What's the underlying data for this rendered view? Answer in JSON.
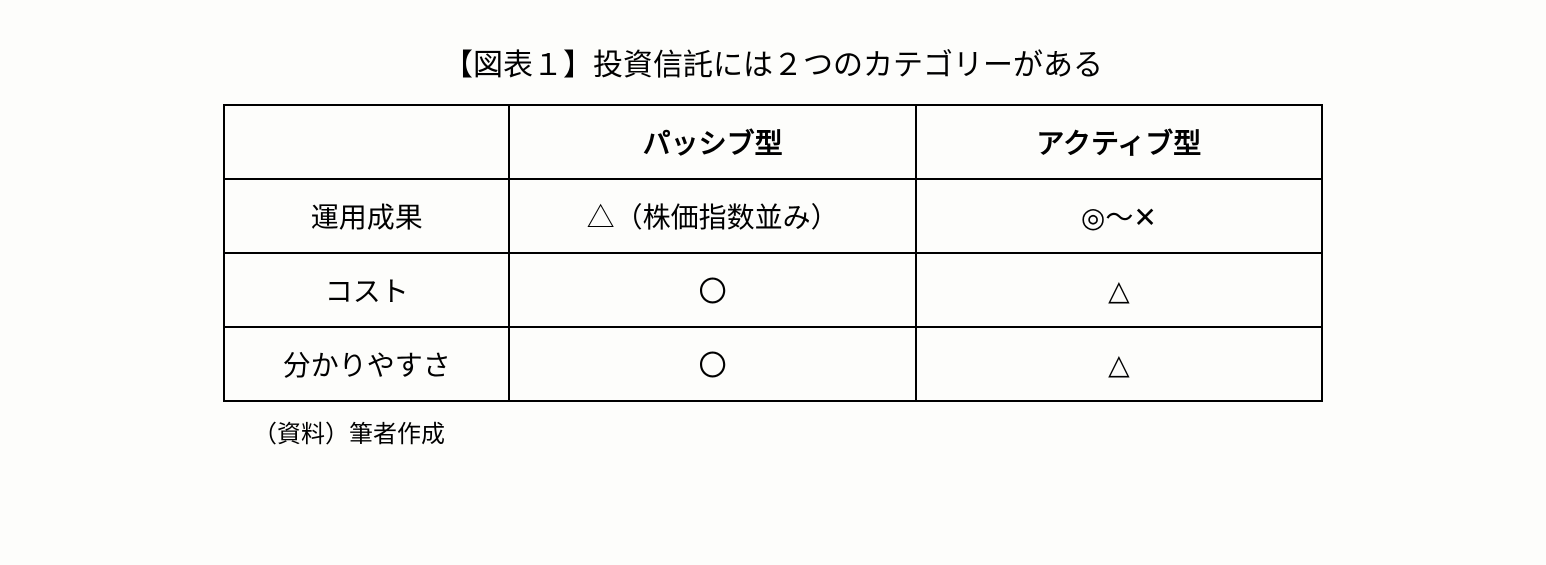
{
  "title": "【図表１】投資信託には２つのカテゴリーがある",
  "headers": {
    "blank": "",
    "col1": "パッシブ型",
    "col2": "アクティブ型"
  },
  "rows": [
    {
      "label": "運用成果",
      "passive": "△（株価指数並み）",
      "active": "◎～✕"
    },
    {
      "label": "コスト",
      "passive": "〇",
      "active": "△"
    },
    {
      "label": "分かりやすさ",
      "passive": "〇",
      "active": "△"
    }
  ],
  "source": "（資料）筆者作成",
  "chart_data": {
    "type": "table",
    "title": "【図表１】投資信託には２つのカテゴリーがある",
    "columns": [
      "",
      "パッシブ型",
      "アクティブ型"
    ],
    "rows": [
      [
        "運用成果",
        "△（株価指数並み）",
        "◎～✕"
      ],
      [
        "コスト",
        "〇",
        "△"
      ],
      [
        "分かりやすさ",
        "〇",
        "△"
      ]
    ],
    "source": "（資料）筆者作成"
  }
}
